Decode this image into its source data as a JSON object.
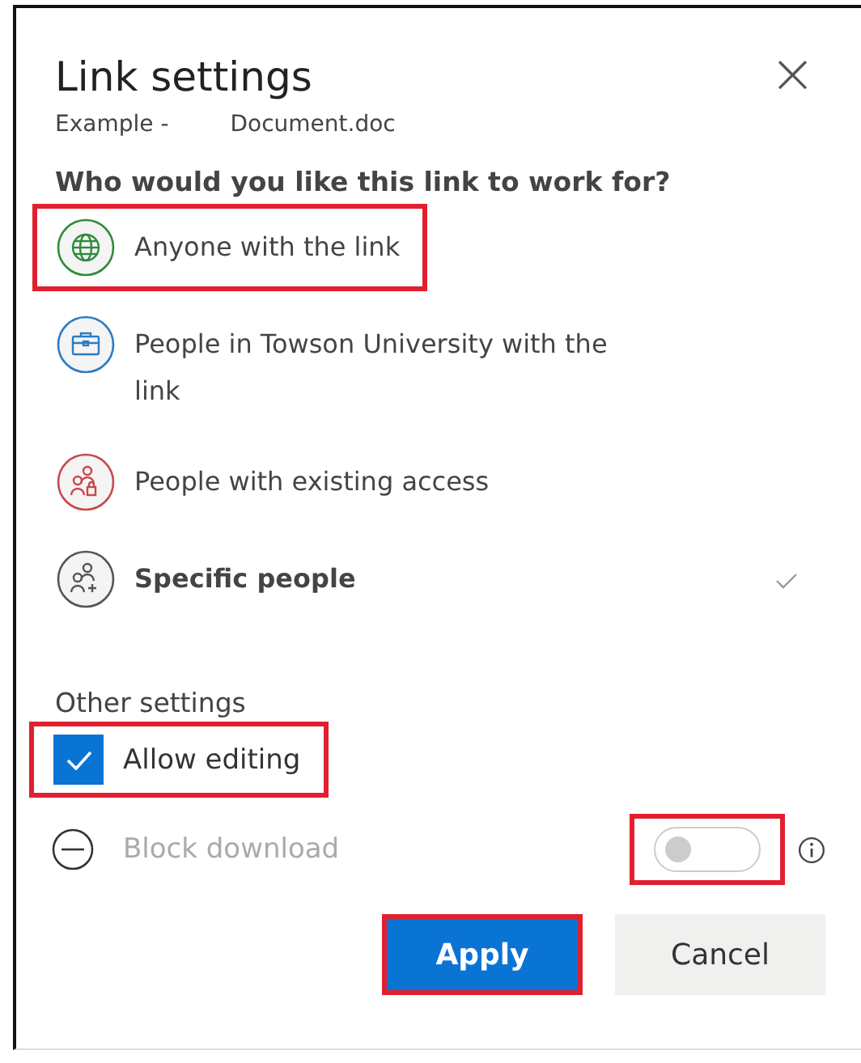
{
  "dialog": {
    "title": "Link settings",
    "subtitle_parts": [
      "Example -",
      "Document.doc"
    ],
    "close": "×"
  },
  "audience": {
    "heading": "Who would you like this link to work for?",
    "options": [
      {
        "label": "Anyone with the link",
        "kind": "globe",
        "color": "#2e8b3a",
        "selected": false,
        "highlighted": true
      },
      {
        "label": "People in Towson University with the link",
        "kind": "briefcase",
        "color": "#2b7cc4",
        "selected": false,
        "highlighted": false
      },
      {
        "label": "People with existing access",
        "kind": "people-lock",
        "color": "#c8484c",
        "selected": false,
        "highlighted": false
      },
      {
        "label": "Specific people",
        "kind": "people-add",
        "color": "#555555",
        "selected": true,
        "highlighted": false
      }
    ]
  },
  "other_settings": {
    "heading": "Other settings",
    "allow_editing": {
      "label": "Allow editing",
      "checked": true,
      "highlighted": true
    },
    "block_download": {
      "label": "Block download",
      "disabled": true,
      "on": false,
      "highlighted": true
    }
  },
  "buttons": [
    {
      "label": "Apply",
      "kind": "primary",
      "highlighted": true
    },
    {
      "label": "Cancel",
      "kind": "secondary",
      "highlighted": false
    }
  ]
}
